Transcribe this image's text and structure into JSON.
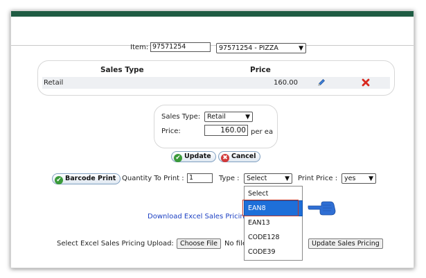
{
  "item": {
    "label": "Item:",
    "code_value": "97571254",
    "selected_item": "97571254 - PIZZA"
  },
  "pricing_table": {
    "headers": [
      "Sales Type",
      "Price"
    ],
    "rows": [
      {
        "sales_type": "Retail",
        "price": "160.00"
      }
    ]
  },
  "edit_form": {
    "sales_type_label": "Sales Type:",
    "sales_type_value": "Retail",
    "price_label": "Price:",
    "price_value": "160.00",
    "unit": "per ea"
  },
  "actions": {
    "update_label": "Update",
    "cancel_label": "Cancel"
  },
  "barcode": {
    "button_label": "Barcode Print",
    "quantity_label": "Quantity To Print :",
    "quantity_value": "1",
    "type_label": "Type :",
    "type_value": "Select",
    "type_options": [
      "Select",
      "EAN8",
      "EAN13",
      "CODE128",
      "CODE39"
    ],
    "highlighted_option": "EAN8",
    "print_price_label": "Print Price :",
    "print_price_value": "yes"
  },
  "excel": {
    "download_link": "Download Excel Sales Pricin",
    "upload_label": "Select Excel Sales Pricing Upload:",
    "choose_file_label": "Choose File",
    "no_file_text": "No file",
    "update_button_label": "Update Sales Pricing"
  },
  "colors": {
    "header_bar": "#1f5c43",
    "highlight_blue": "#1e6fd9",
    "annotation_red": "#c0392b",
    "pointer_blue": "#2f6fd4"
  }
}
